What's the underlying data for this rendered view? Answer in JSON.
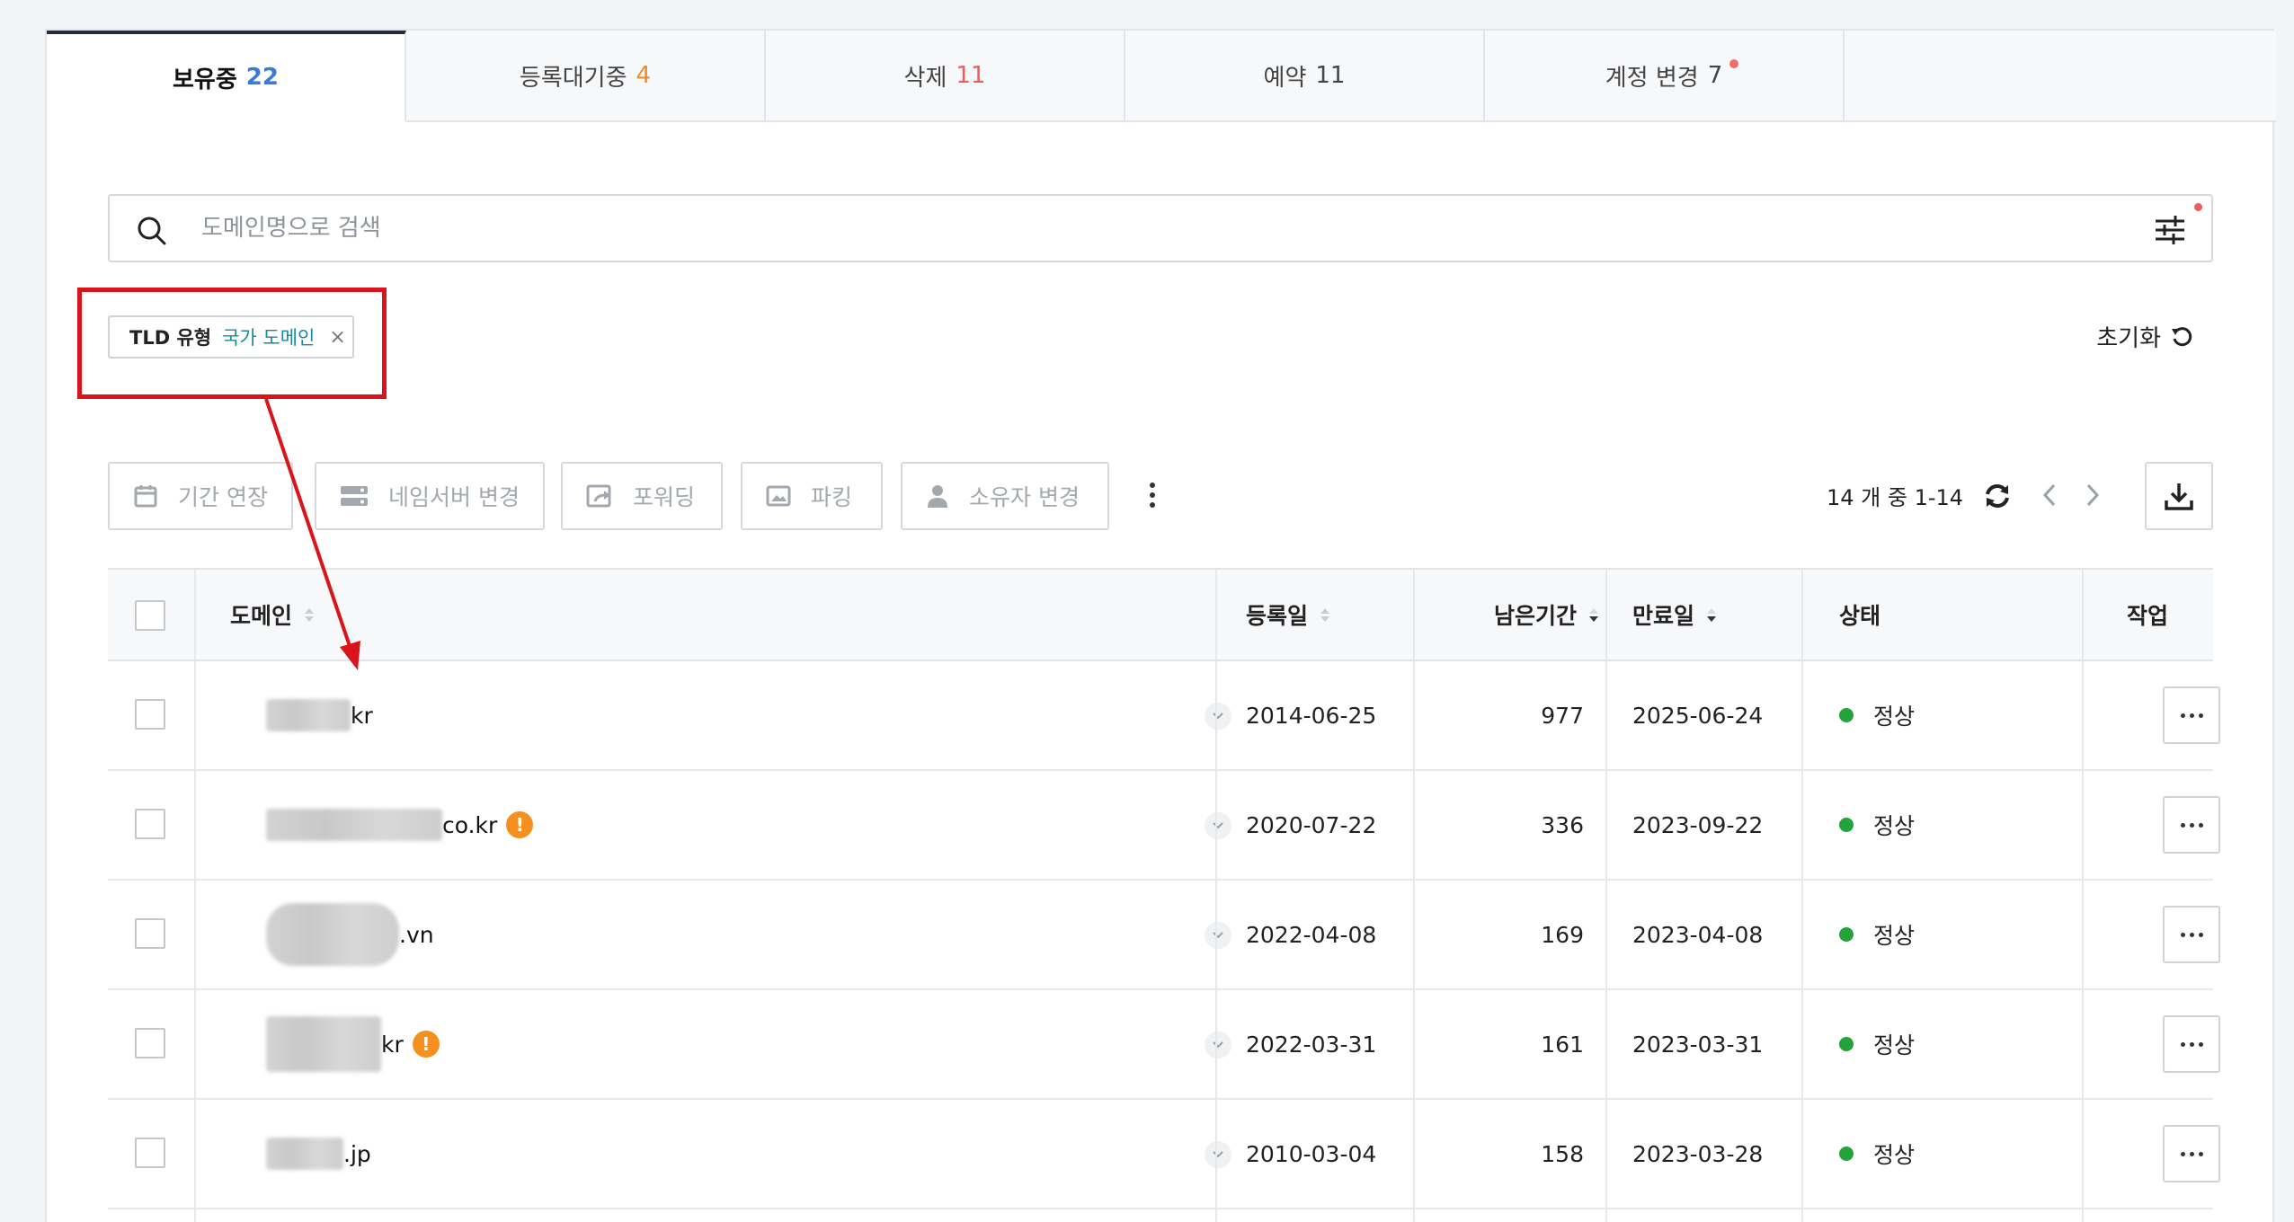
{
  "tabs": [
    {
      "label": "보유중",
      "count": "22",
      "active": true
    },
    {
      "label": "등록대기중",
      "count": "4"
    },
    {
      "label": "삭제",
      "count": "11"
    },
    {
      "label": "예약",
      "count": "11"
    },
    {
      "label": "계정 변경",
      "count": "7",
      "has_dot": true
    }
  ],
  "search": {
    "placeholder": "도메인명으로 검색"
  },
  "filter_chip": {
    "label": "TLD 유형",
    "value": "국가 도메인",
    "remove": "×"
  },
  "reset_label": "초기화",
  "actions": [
    "기간 연장",
    "네임서버 변경",
    "포워딩",
    "파킹",
    "소유자 변경"
  ],
  "pagination": {
    "text": "14 개 중 1-14"
  },
  "table": {
    "headers": {
      "domain": "도메인",
      "registered": "등록일",
      "remaining": "남은기간",
      "expires": "만료일",
      "status": "상태",
      "action": "작업"
    },
    "rows": [
      {
        "tld": "kr",
        "registered": "2014-06-25",
        "remaining": "977",
        "expires": "2025-06-24",
        "status": "정상",
        "warning": false
      },
      {
        "tld": "co.kr",
        "registered": "2020-07-22",
        "remaining": "336",
        "expires": "2023-09-22",
        "status": "정상",
        "warning": true
      },
      {
        "tld": ".vn",
        "registered": "2022-04-08",
        "remaining": "169",
        "expires": "2023-04-08",
        "status": "정상",
        "warning": false
      },
      {
        "tld": "kr",
        "registered": "2022-03-31",
        "remaining": "161",
        "expires": "2023-03-31",
        "status": "정상",
        "warning": true
      },
      {
        "tld": ".jp",
        "registered": "2010-03-04",
        "remaining": "158",
        "expires": "2023-03-28",
        "status": "정상",
        "warning": false
      }
    ]
  },
  "warning_glyph": "!",
  "colors": {
    "accent_blue": "#3a7bd5",
    "accent_orange": "#f28b22",
    "accent_red": "#f25b5b",
    "status_ok": "#23a33a",
    "annotation_red": "#d9141b"
  }
}
